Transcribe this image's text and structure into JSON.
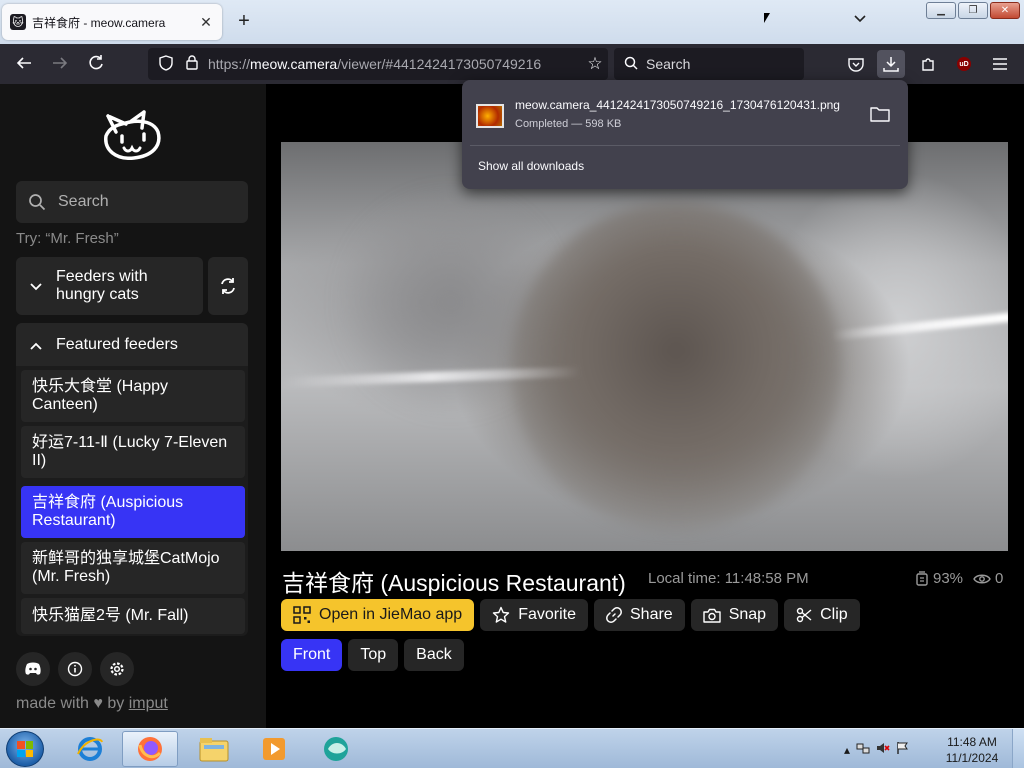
{
  "browser": {
    "tab_title": "吉祥食府 - meow.camera",
    "url_prefix": "https://",
    "url_host": "meow.camera",
    "url_path": "/viewer/#4412424173050749216",
    "search_placeholder": "Search",
    "ublock_badge": "uD"
  },
  "downloads": {
    "filename": "meow.camera_4412424173050749216_1730476120431.png",
    "status": "Completed — 598 KB",
    "show_all": "Show all downloads"
  },
  "sidebar": {
    "search_placeholder": "Search",
    "try_hint": "Try: “Mr. Fresh”",
    "group_hungry": "Feeders with hungry cats",
    "group_featured": "Featured feeders",
    "feeders": [
      {
        "label": "快乐大食堂 (Happy Canteen)"
      },
      {
        "label": "好运7-11-Ⅱ (Lucky 7-Eleven II)"
      },
      {
        "label": "吉祥食府 (Auspicious Restaurant)"
      },
      {
        "label": "新鲜哥的独享城堡CatMojo (Mr. Fresh)"
      },
      {
        "label": "快乐猫屋2号 (Mr. Fall)"
      }
    ],
    "made_with_prefix": "made with",
    "made_with_by": "by",
    "made_with_author": "imput"
  },
  "main": {
    "camera_title": "吉祥食府 (Auspicious Restaurant)",
    "local_time": "Local time: 11:48:58 PM",
    "food_level": "93%",
    "viewers": "0",
    "actions": {
      "open_app": "Open in JieMao app",
      "favorite": "Favorite",
      "share": "Share",
      "snap": "Snap",
      "clip": "Clip"
    },
    "views": {
      "front": "Front",
      "top": "Top",
      "back": "Back"
    }
  },
  "taskbar": {
    "time": "11:48 AM",
    "date": "11/1/2024"
  },
  "colors": {
    "accent_blue": "#3734f5",
    "accent_yellow": "#f5c42c"
  }
}
